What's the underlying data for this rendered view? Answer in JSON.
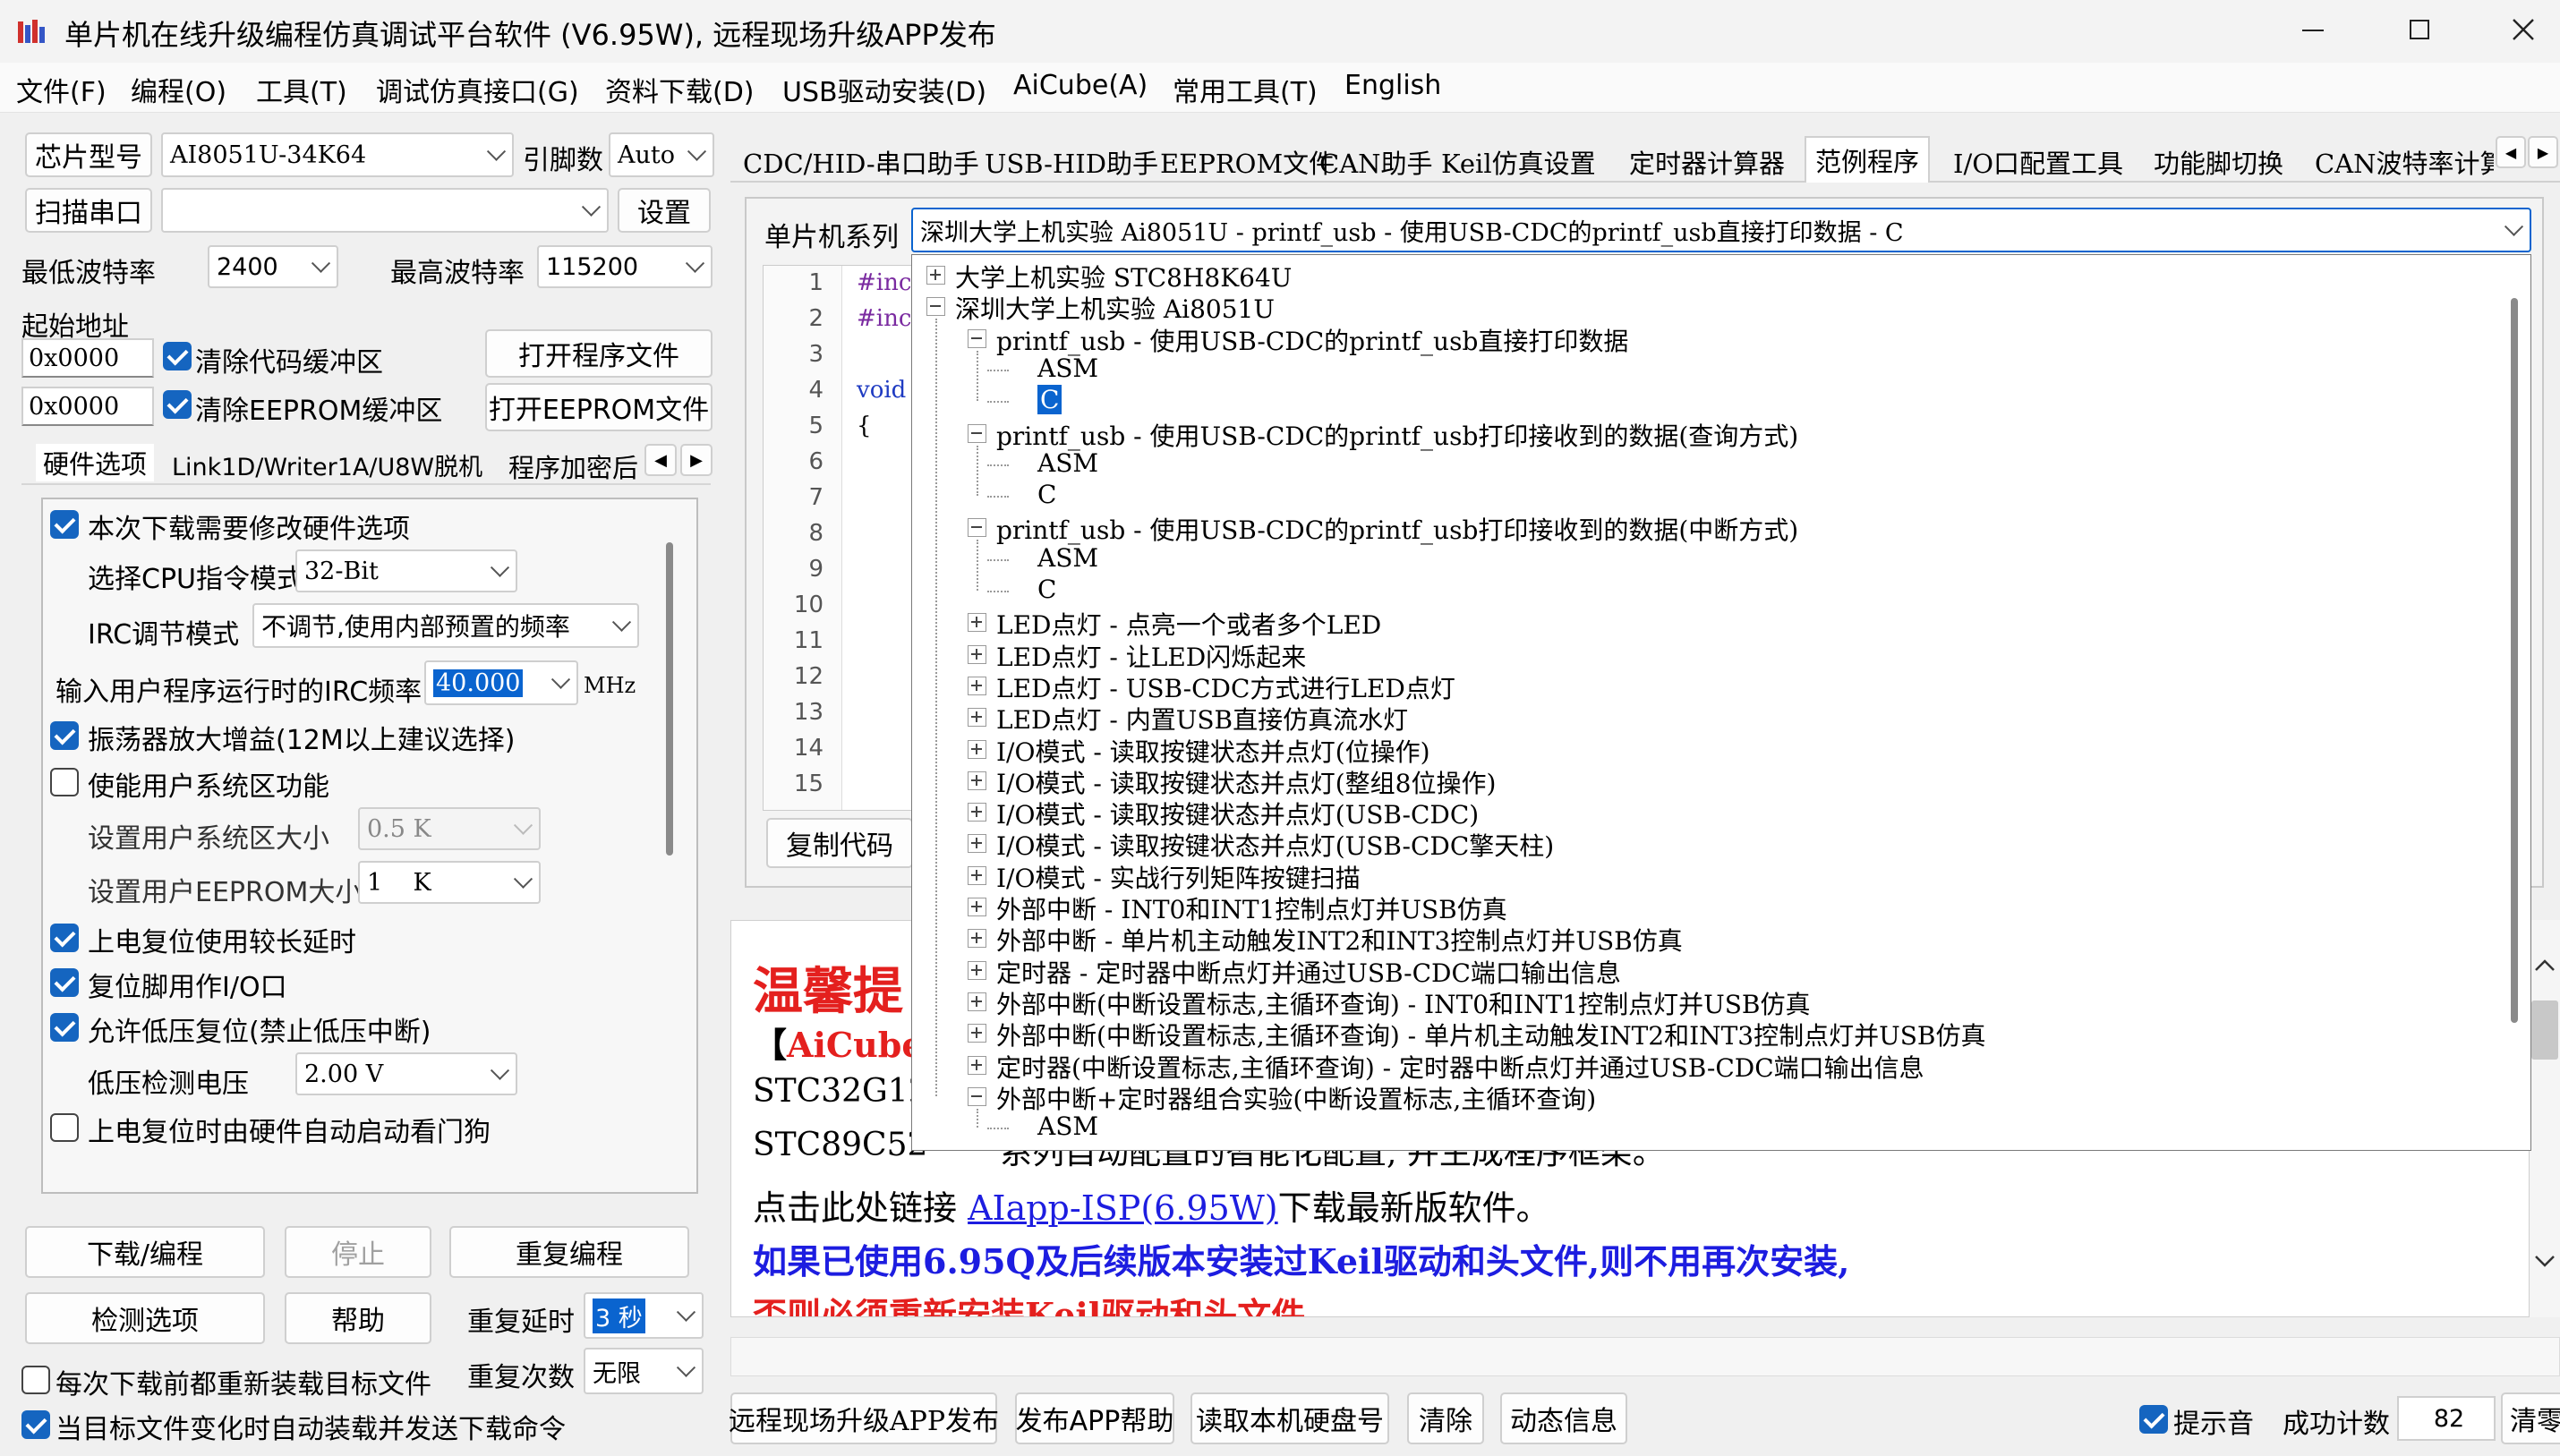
{
  "window": {
    "title": "单片机在线升级编程仿真调试平台软件 (V6.95W), 远程现场升级APP发布"
  },
  "menu": [
    "文件(F)",
    "编程(O)",
    "工具(T)",
    "调试仿真接口(G)",
    "资料下载(D)",
    "USB驱动安装(D)",
    "AiCube(A)",
    "常用工具(T)",
    "English"
  ],
  "left": {
    "chip_label": "芯片型号",
    "chip_value": "AI8051U-34K64",
    "pin_label": "引脚数",
    "pin_value": "Auto",
    "scan_btn": "扫描串口",
    "settings_btn": "设置",
    "min_baud_label": "最低波特率",
    "min_baud": "2400",
    "max_baud_label": "最高波特率",
    "max_baud": "115200",
    "start_addr_label": "起始地址",
    "addr1": "0x0000",
    "clear_code": "清除代码缓冲区",
    "open_prog": "打开程序文件",
    "addr2": "0x0000",
    "clear_eeprom": "清除EEPROM缓冲区",
    "open_eeprom": "打开EEPROM文件",
    "tabs": [
      "硬件选项",
      "Link1D/Writer1A/U8W脱机",
      "程序加密后"
    ],
    "hw": {
      "modify": "本次下载需要修改硬件选项",
      "cpu_label": "选择CPU指令模式",
      "cpu_value": "32-Bit",
      "irc_label": "IRC调节模式",
      "irc_value": "不调节,使用内部预置的频率",
      "freq_label": "输入用户程序运行时的IRC频率",
      "freq_value": "40.000",
      "freq_unit": "MHz",
      "osc_gain": "振荡器放大增益(12M以上建议选择)",
      "user_sys": "使能用户系统区功能",
      "sys_size_label": "设置用户系统区大小",
      "sys_size": "0.5 K",
      "eeprom_size_label": "设置用户EEPROM大小",
      "eeprom_size": "1    K",
      "power_delay": "上电复位使用较长延时",
      "reset_io": "复位脚用作I/O口",
      "low_volt_reset": "允许低压复位(禁止低压中断)",
      "low_volt_label": "低压检测电压",
      "low_volt": "2.00 V",
      "watchdog": "上电复位时由硬件自动启动看门狗"
    },
    "download_btn": "下载/编程",
    "stop_btn": "停止",
    "reprog_btn": "重复编程",
    "check_btn": "检测选项",
    "help_btn": "帮助",
    "repeat_delay_label": "重复延时",
    "repeat_delay": "3 秒",
    "repeat_count_label": "重复次数",
    "repeat_count": "无限",
    "reload_each": "每次下载前都重新装载目标文件",
    "auto_reload": "当目标文件变化时自动装载并发送下载命令"
  },
  "tabs": [
    "CDC/HID-串口助手",
    "USB-HID助手",
    "EEPROM文件",
    "CAN助手",
    "Keil仿真设置",
    "定时器计算器",
    "范例程序",
    "I/O口配置工具",
    "功能脚切换",
    "CAN波特率计算"
  ],
  "active_tab": "范例程序",
  "series_label": "单片机系列",
  "series_value": "深圳大学上机实验 Ai8051U - printf_usb - 使用USB-CDC的printf_usb直接打印数据 - C",
  "code_lines": [
    "1",
    "2",
    "3",
    "4",
    "5",
    "6",
    "7",
    "8",
    "9",
    "10",
    "11",
    "12",
    "13",
    "14",
    "15"
  ],
  "code_text": [
    "#inc",
    "#inc",
    "",
    "void",
    "{"
  ],
  "copy_btn": "复制代码",
  "tree": [
    {
      "t": "大学上机实验 STC8H8K64U",
      "l": 0,
      "e": "+"
    },
    {
      "t": "深圳大学上机实验 Ai8051U",
      "l": 0,
      "e": "-"
    },
    {
      "t": "printf_usb - 使用USB-CDC的printf_usb直接打印数据",
      "l": 1,
      "e": "-"
    },
    {
      "t": "ASM",
      "l": 2
    },
    {
      "t": "C",
      "l": 2,
      "sel": true
    },
    {
      "t": "printf_usb - 使用USB-CDC的printf_usb打印接收到的数据(查询方式)",
      "l": 1,
      "e": "-"
    },
    {
      "t": "ASM",
      "l": 2
    },
    {
      "t": "C",
      "l": 2
    },
    {
      "t": "printf_usb - 使用USB-CDC的printf_usb打印接收到的数据(中断方式)",
      "l": 1,
      "e": "-"
    },
    {
      "t": "ASM",
      "l": 2
    },
    {
      "t": "C",
      "l": 2
    },
    {
      "t": "LED点灯 - 点亮一个或者多个LED",
      "l": 1,
      "e": "+"
    },
    {
      "t": "LED点灯 - 让LED闪烁起来",
      "l": 1,
      "e": "+"
    },
    {
      "t": "LED点灯 - USB-CDC方式进行LED点灯",
      "l": 1,
      "e": "+"
    },
    {
      "t": "LED点灯 - 内置USB直接仿真流水灯",
      "l": 1,
      "e": "+"
    },
    {
      "t": "I/O模式 - 读取按键状态并点灯(位操作)",
      "l": 1,
      "e": "+"
    },
    {
      "t": "I/O模式 - 读取按键状态并点灯(整组8位操作)",
      "l": 1,
      "e": "+"
    },
    {
      "t": "I/O模式 - 读取按键状态并点灯(USB-CDC)",
      "l": 1,
      "e": "+"
    },
    {
      "t": "I/O模式 - 读取按键状态并点灯(USB-CDC擎天柱)",
      "l": 1,
      "e": "+"
    },
    {
      "t": "I/O模式 - 实战行列矩阵按键扫描",
      "l": 1,
      "e": "+"
    },
    {
      "t": "外部中断 - INT0和INT1控制点灯并USB仿真",
      "l": 1,
      "e": "+"
    },
    {
      "t": "外部中断 - 单片机主动触发INT2和INT3控制点灯并USB仿真",
      "l": 1,
      "e": "+"
    },
    {
      "t": "定时器 - 定时器中断点灯并通过USB-CDC端口输出信息",
      "l": 1,
      "e": "+"
    },
    {
      "t": "外部中断(中断设置标志,主循环查询) - INT0和INT1控制点灯并USB仿真",
      "l": 1,
      "e": "+"
    },
    {
      "t": "外部中断(中断设置标志,主循环查询) - 单片机主动触发INT2和INT3控制点灯并USB仿真",
      "l": 1,
      "e": "+"
    },
    {
      "t": "定时器(中断设置标志,主循环查询) - 定时器中断点灯并通过USB-CDC端口输出信息",
      "l": 1,
      "e": "+"
    },
    {
      "t": "外部中断+定时器组合实验(中断设置标志,主循环查询)",
      "l": 1,
      "e": "-"
    },
    {
      "t": "ASM",
      "l": 2
    }
  ],
  "info": {
    "heading": "温馨提",
    "aicube_bracket": "【",
    "aicube": "AiCube",
    "line_stc32": "STC32G12",
    "line_stc89a": "STC89C52",
    "line_stc89b": "系列自动配置的智能化配置, 并生成程序框架。",
    "link_pre": "点击此处链接",
    "link": "AIapp-ISP(6.95W)",
    "link_post": "下载最新版软件。",
    "blue": "如果已使用6.95Q及后续版本安装过Keil驱动和头文件,则不用再次安装,",
    "red": "否则必须重新安装Keil驱动和头文件"
  },
  "bottom": {
    "remote_btn": "远程现场升级APP发布",
    "app_help_btn": "发布APP帮助",
    "read_disk_btn": "读取本机硬盘号",
    "clear_btn": "清除",
    "dyn_btn": "动态信息",
    "sound": "提示音",
    "count_label": "成功计数",
    "count": "82",
    "zero_btn": "清零"
  },
  "colors": {
    "accent": "#1565c0",
    "selection": "#0a64cf",
    "heading_red": "#e4201e",
    "blue_text": "#1d1de0"
  }
}
